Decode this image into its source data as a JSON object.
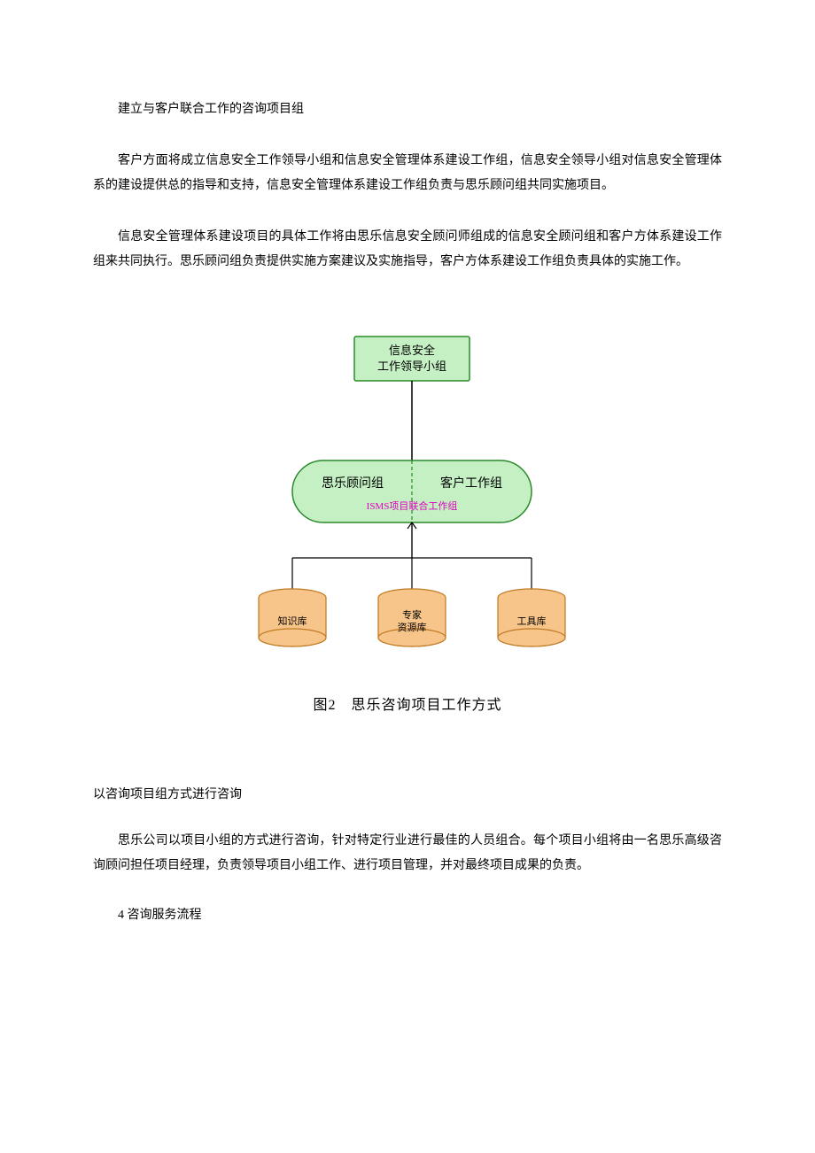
{
  "paragraphs": {
    "h1": "建立与客户联合工作的咨询项目组",
    "p1": "客户方面将成立信息安全工作领导小组和信息安全管理体系建设工作组，信息安全领导小组对信息安全管理体系的建设提供总的指导和支持，信息安全管理体系建设工作组负责与思乐顾问组共同实施项目。",
    "p2": "信息安全管理体系建设项目的具体工作将由思乐信息安全顾问师组成的信息安全顾问组和客户方体系建设工作组来共同执行。思乐顾问组负责提供实施方案建议及实施指导，客户方体系建设工作组负责具体的实施工作。",
    "h2": "以咨询项目组方式进行咨询",
    "p3": "思乐公司以项目小组的方式进行咨询，针对特定行业进行最佳的人员组合。每个项目小组将由一名思乐高级咨询顾问担任项目经理，负责领导项目小组工作、进行项目管理，并对最终项目成果的负责。",
    "h3": "4 咨询服务流程"
  },
  "diagram": {
    "top_box_line1": "信息安全",
    "top_box_line2": "工作领导小组",
    "mid_left": "思乐顾问组",
    "mid_right": "客户工作组",
    "mid_sub": "ISMS项目联合工作组",
    "cyl1_label": "知识库",
    "cyl2_line1": "专家",
    "cyl2_line2": "资源库",
    "cyl3_label": "工具库",
    "caption": "图2　思乐咨询项目工作方式",
    "colors": {
      "green_fill": "#c4f0c4",
      "green_stroke": "#2a8a2a",
      "orange_fill": "#f7c58a",
      "orange_stroke": "#c07820",
      "line": "#000000",
      "dash": "#2a8a2a"
    }
  }
}
